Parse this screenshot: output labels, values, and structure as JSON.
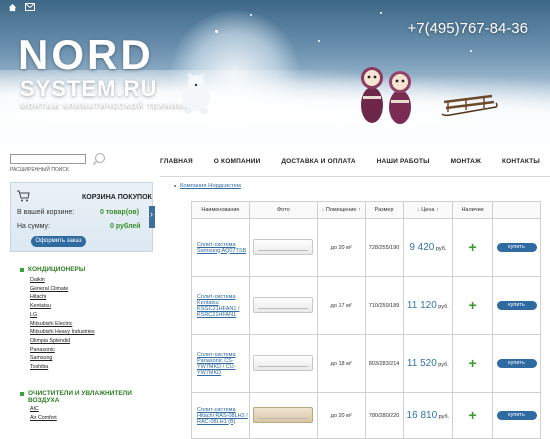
{
  "header": {
    "logo_line1": "NORD",
    "logo_line2": "SYSTEM.RU",
    "tagline": "МОНТАЖ КЛИМАТИЧЕСКОЙ ТЕХНИКИ",
    "phone": "+7(495)767-84-36",
    "top_icons": [
      "home-icon",
      "mail-icon"
    ]
  },
  "search": {
    "placeholder": "",
    "advanced_label": "РАСШИРЕННЫЙ ПОИСК"
  },
  "nav": [
    {
      "label": "ГЛАВНАЯ"
    },
    {
      "label": "О КОМПАНИИ"
    },
    {
      "label": "ДОСТАВКА И ОПЛАТА"
    },
    {
      "label": "НАШИ РАБОТЫ"
    },
    {
      "label": "МОНТАЖ"
    },
    {
      "label": "КОНТАКТЫ"
    }
  ],
  "cart": {
    "title": "КОРЗИНА ПОКУПОК",
    "items_label": "В вашей корзине:",
    "items_value": "0 товар(ов)",
    "sum_label": "На сумму:",
    "sum_value": "0 рублей",
    "order_button": "Оформить заказ"
  },
  "categories": [
    {
      "title": "КОНДИЦИОНЕРЫ",
      "items": [
        "Daikin",
        "General Climate",
        "Hitachi",
        "Kentatsu",
        "LG",
        "Mitsubishi Electric",
        "Mitsubishi Heavy Industries",
        "Olimpia Splendid",
        "Panasonic",
        "Samsung",
        "Toshiba"
      ]
    },
    {
      "title": "ОЧИСТИТЕЛИ И УВЛАЖНИТЕЛИ ВОЗДУХА",
      "items": [
        "AIC",
        "Air Comfort"
      ]
    }
  ],
  "breadcrumb": "Компания Нордсистем",
  "table": {
    "headers": {
      "name": "Наименование",
      "photo": "Фото",
      "area": "Помещение",
      "size": "Размер",
      "price": "Цена",
      "availability": "Наличие"
    },
    "rows": [
      {
        "name": "Сплит-система Samsung AQ07TSB",
        "area": "до 20 м²",
        "size": "728/255/190",
        "price": "9 420",
        "currency": "руб.",
        "buy": "купить",
        "photo_style": "white"
      },
      {
        "name": "Сплит-система Kentatsu KSGC21HFAN1 / KSRC21HFAN1",
        "area": "до 17 м²",
        "size": "710/250/189",
        "price": "11 120",
        "currency": "руб.",
        "buy": "купить",
        "photo_style": "white"
      },
      {
        "name": "Сплит-система Panasonic CS-YW7MKD / CU-YW7MKD",
        "area": "до 18 м²",
        "size": "803/283/214",
        "price": "11 520",
        "currency": "руб.",
        "buy": "купить",
        "photo_style": "white"
      },
      {
        "name": "Сплит-система Hitachi RAS-08LH2 / RAC-08LH1 (В)",
        "area": "до 20 м²",
        "size": "780/280/220",
        "price": "16 810",
        "currency": "руб.",
        "buy": "купить",
        "photo_style": "gold"
      }
    ]
  }
}
